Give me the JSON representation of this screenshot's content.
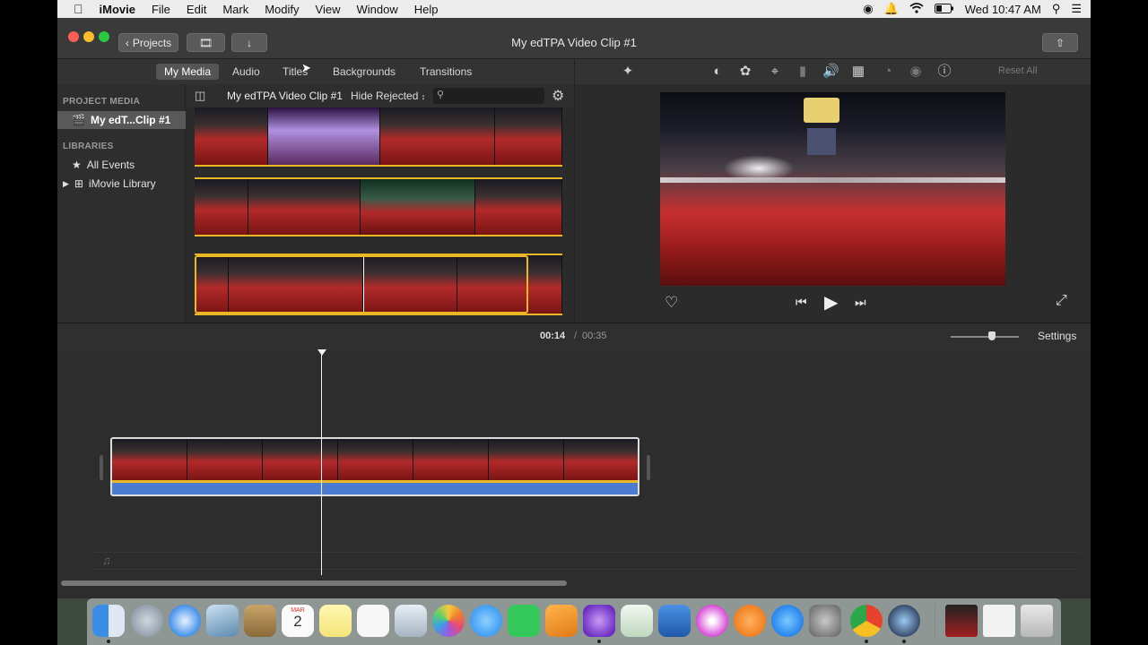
{
  "menubar": {
    "app_name": "iMovie",
    "items": [
      "File",
      "Edit",
      "Mark",
      "Modify",
      "View",
      "Window",
      "Help"
    ],
    "clock": "Wed 10:47 AM"
  },
  "window": {
    "title": "My edTPA Video Clip #1",
    "projects_button": "Projects"
  },
  "media_tabs": [
    {
      "label": "My Media",
      "active": true
    },
    {
      "label": "Audio",
      "active": false
    },
    {
      "label": "Titles",
      "active": false
    },
    {
      "label": "Backgrounds",
      "active": false
    },
    {
      "label": "Transitions",
      "active": false
    }
  ],
  "viewer_tools": {
    "icons": [
      "magic-wand-icon",
      "color-balance-icon",
      "color-correction-icon",
      "crop-icon",
      "stabilization-icon",
      "volume-icon",
      "equalizer-icon",
      "speed-icon",
      "clip-filter-icon",
      "info-icon"
    ],
    "reset_all_label": "Reset All"
  },
  "sidebar": {
    "project_media_header": "PROJECT MEDIA",
    "project_item": "My edT...Clip #1",
    "libraries_header": "LIBRARIES",
    "all_events": "All Events",
    "library": "iMovie Library"
  },
  "browser": {
    "title": "My edTPA Video Clip #1",
    "filter": "Hide Rejected",
    "search_placeholder": ""
  },
  "timeline": {
    "current_time": "00:14",
    "separator": "/",
    "total_time": "00:35",
    "settings_label": "Settings",
    "zoom_level": 0.6
  },
  "dock": {
    "apps": [
      "Finder",
      "Launchpad",
      "Safari",
      "Preview",
      "Contacts",
      "Calendar",
      "Notes",
      "Reminders",
      "Photo Booth",
      "Photos",
      "Messages",
      "FaceTime",
      "Pages",
      "iMovie",
      "Numbers",
      "Keynote",
      "iTunes",
      "iBooks",
      "App Store",
      "System Preferences",
      "Google Chrome",
      "QuickTime Player",
      "Screenshot",
      "Document",
      "Trash"
    ],
    "calendar_month": "MAR",
    "calendar_day": "2"
  },
  "colors": {
    "accent_yellow": "#e9b824",
    "audio_blue": "#4a7bd0",
    "window_bg": "#2b2b2b"
  }
}
